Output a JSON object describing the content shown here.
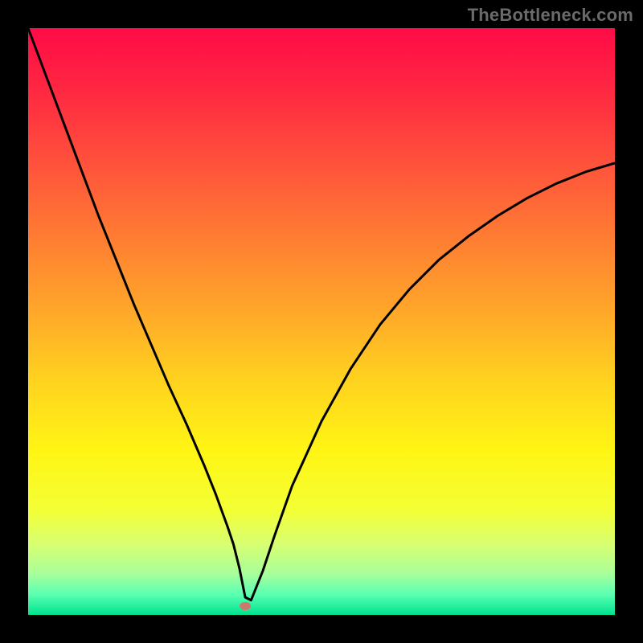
{
  "watermark": "TheBottleneck.com",
  "colors": {
    "background": "#000000",
    "curve": "#000000",
    "marker": "#c97a6b",
    "gradient_stops": [
      {
        "offset": 0.0,
        "color": "#ff0b46"
      },
      {
        "offset": 0.1,
        "color": "#ff2642"
      },
      {
        "offset": 0.22,
        "color": "#ff4e3c"
      },
      {
        "offset": 0.35,
        "color": "#ff7a33"
      },
      {
        "offset": 0.48,
        "color": "#ffa62a"
      },
      {
        "offset": 0.6,
        "color": "#ffd21f"
      },
      {
        "offset": 0.72,
        "color": "#fff514"
      },
      {
        "offset": 0.82,
        "color": "#f4ff34"
      },
      {
        "offset": 0.88,
        "color": "#d7ff72"
      },
      {
        "offset": 0.93,
        "color": "#a8ff9a"
      },
      {
        "offset": 0.965,
        "color": "#5bffb2"
      },
      {
        "offset": 1.0,
        "color": "#00e38f"
      }
    ]
  },
  "chart_data": {
    "type": "line",
    "title": "",
    "xlabel": "",
    "ylabel": "",
    "xlim": [
      0,
      100
    ],
    "ylim": [
      0,
      100
    ],
    "grid": false,
    "legend": false,
    "marker": {
      "x": 37,
      "y": 1.5
    },
    "series": [
      {
        "name": "bottleneck-curve",
        "x": [
          0,
          3,
          6,
          9,
          12,
          15,
          18,
          21,
          24,
          27,
          30,
          32,
          34,
          35,
          36,
          37,
          38,
          40,
          42,
          45,
          50,
          55,
          60,
          65,
          70,
          75,
          80,
          85,
          90,
          95,
          100
        ],
        "values": [
          100,
          92,
          84,
          76,
          68,
          60.5,
          53,
          46,
          39,
          32.5,
          25.5,
          20.5,
          15,
          12,
          8,
          3,
          2.5,
          7.5,
          13.5,
          22,
          33,
          42,
          49.5,
          55.5,
          60.5,
          64.5,
          68,
          71,
          73.5,
          75.5,
          77
        ]
      }
    ]
  }
}
